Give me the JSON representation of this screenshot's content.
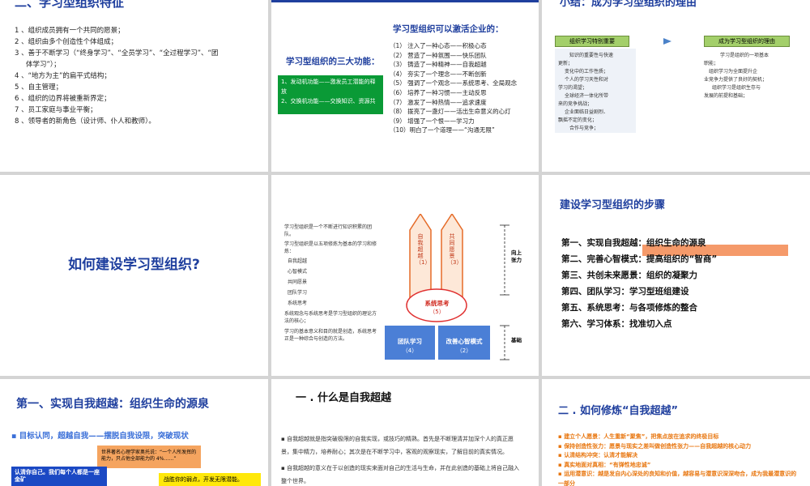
{
  "s1": {
    "title": "二、学习型组织特征",
    "items": [
      "1 、组织成员拥有一个共同的愿景；",
      "2 、组织由多个创造性个体组成；",
      "3 、善于不断学习（“终身学习”、“全员学习”、“全过程学习”、“团",
      "体学习”）；",
      "4 、“地方为主”的扁平式结构；",
      "5 、自主管理；",
      "6 、组织的边界将被重新界定；",
      "7 、员工家庭与事业平衡；",
      "8 、领导者的新角色（设计师、仆人和教师）。"
    ]
  },
  "s2": {
    "title": "学习型组织可以激活企业的：",
    "left_title": "学习型组织的三大功能：",
    "functions": [
      "1、发动机功能——激发员工潜能的释放",
      "2、交换机功能——交换知识、资源共"
    ],
    "items": [
      "（1）  注入了一种心态——积极心态",
      "（2）  营造了一种氛围——快乐团队",
      "（3）  铸造了一种精神——自我超越",
      "（4）  夯实了一个理念——不断创新",
      "（5）  强调了一个观念——系统思考、全局观念",
      "（6）  培养了一种习惯——主动反思",
      "（7）  激发了一种热情——追求速度",
      "（8）  拨亮了一盏灯——活出生命意义的心灯",
      "（9）  增强了一个恨——学习力",
      "（10）明白了一个道理——“沟通无限”"
    ]
  },
  "s3": {
    "title": "小结：成为学习型组织的理由",
    "box_left": "组织学习特别重要",
    "box_right": "成为学习型组织的理由",
    "left_text": [
      "知识的重要性与快速",
      "更新；",
      "变化中的工作性质；",
      "个人的学习天性和对",
      "学习的渴望；",
      "全球经济一体化所带",
      "来的竞争挑战；",
      "企业面临日益剧烈、",
      "飘摇不定的变化；",
      "合作与竞争；"
    ],
    "right_text": [
      "学习是组织的一项基本",
      "职能；",
      "组织学习为全面提升企",
      "业竞争力提供了良好的契机；",
      "组织学习是组织生存与",
      "发展的前提和基础；"
    ]
  },
  "s4": {
    "title": "如何建设学习型组织?"
  },
  "s5": {
    "bullets": [
      "学习型组织是一个不断进行知识积累的团队。",
      "学习型组织是以五项修炼为基本的学习和修炼：",
      "自我超越",
      "心智模式",
      "共同愿景",
      "团队学习",
      "系统思考",
      "系统观念与系统思考是学习型组织的理论方法的核心；",
      "学习的基本意义和目的就是创造，系统思考正是一种综合与创造的方法。"
    ],
    "pencil1": "自我超越（1）",
    "pencil2": "共同愿景（3）",
    "circle": "系统思考",
    "circle_num": "（5）",
    "box1": "团队学习",
    "box1_num": "（4）",
    "box2": "改善心智模式",
    "box2_num": "（2）",
    "label_up": "向上张力",
    "label_base": "基础"
  },
  "s6": {
    "title": "建设学习型组织的步骤",
    "steps": [
      "第一、实现自我超越：组织生命的源泉",
      "第二、完善心智模式：提高组织的“智商”",
      "第三、共创未来愿景：组织的凝聚力",
      "第四、团队学习：学习型班组建设",
      "第五、系统思考：与各项修炼的整合",
      "第六、学习体系：找准切入点"
    ]
  },
  "s7": {
    "title": "第一、实现自我超越：组织生命的源泉",
    "subtitle": "目标认同，超越自我——摆脱自我设限，突破现状",
    "quote": "世界著名心理学家奥托说：“一个人所发挥的能力，只占他全部能力的 4%……”",
    "blue_text": "认清你自己。我们每个人都是一座金矿",
    "yellow_text": "战胜你的弱点，开发无限潜能。"
  },
  "s8": {
    "title": "一 . 什么是自我超越",
    "para1": "自我超越就是指突破极限的自我实现，或技巧的精熟。首先是不断理清并加深个人的真正愿景，集中精力，培养耐心；其次是在不断学习中，客观的观察现实，了解目前的真实情况。",
    "para2": "自我超越的意义在于以创造的现实来面对自己的生活与生命，并在此创造的基础上将自己融入整个世界。"
  },
  "s9": {
    "title": "二 . 如何修炼“自我超越”",
    "items": [
      "建立个人愿景：人生重新“聚焦”，把焦点放在追求的终极目标",
      "保持创造性张力：愿景与现实之差叫做创造性张力——自我超越的核心动力",
      "认清结构冲突：认清才能解决",
      "真实地面对真相：“有弹性地忠诚”",
      "运用潜意识：越是发自内心深处的良知和价值，越容易与潜意识深深吻合，成为我最潜意识的一部分"
    ]
  },
  "colors": {
    "title_blue": "#1f3f9e",
    "green_bar": "#0a9a36",
    "orange": "#e8760f"
  }
}
